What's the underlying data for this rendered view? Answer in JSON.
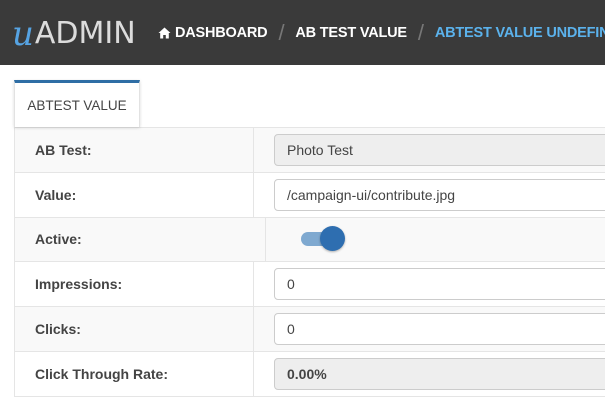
{
  "header": {
    "logo_mark": "u",
    "logo_text": "ADMIN",
    "breadcrumbs": [
      {
        "label": "DASHBOARD",
        "icon": "home-icon"
      },
      {
        "label": "AB TEST VALUE"
      },
      {
        "label": "ABTEST VALUE UNDEFINED",
        "active": true
      }
    ]
  },
  "tab": {
    "label": "ABTEST VALUE"
  },
  "form": {
    "ab_test": {
      "label": "AB Test:",
      "value": "Photo Test"
    },
    "value": {
      "label": "Value:",
      "value": "/campaign-ui/contribute.jpg"
    },
    "active": {
      "label": "Active:",
      "on": true
    },
    "impressions": {
      "label": "Impressions:",
      "value": "0"
    },
    "clicks": {
      "label": "Clicks:",
      "value": "0"
    },
    "ctr": {
      "label": "Click Through Rate:",
      "value": "0.00%"
    }
  },
  "colors": {
    "topbar": "#3a3a3a",
    "accent": "#5bb2ec",
    "tab_border": "#2f6ea5",
    "toggle_on": "#2e6eb0"
  }
}
